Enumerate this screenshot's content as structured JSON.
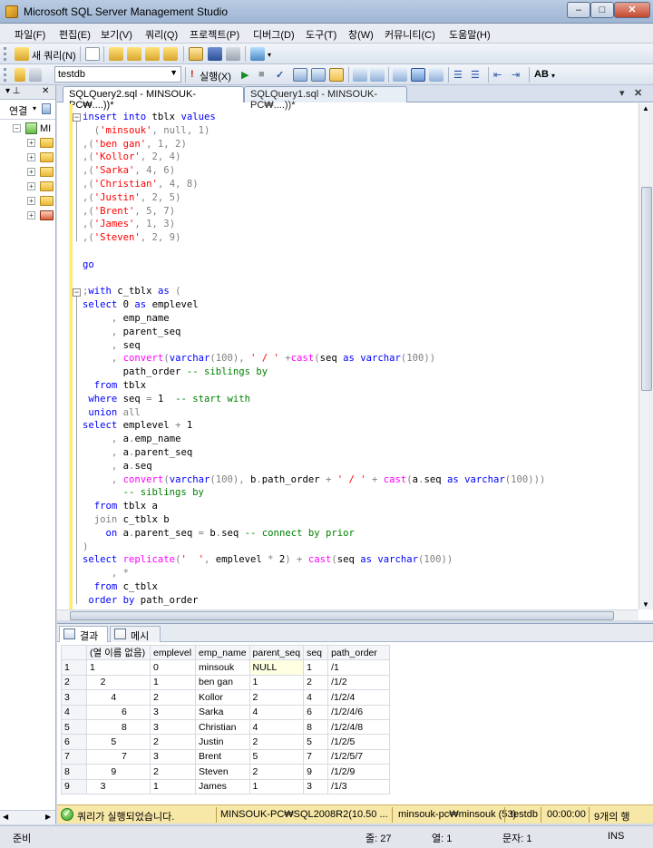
{
  "window": {
    "title": "Microsoft SQL Server Management Studio"
  },
  "menu": [
    "파일(F)",
    "편집(E)",
    "보기(V)",
    "쿼리(Q)",
    "프로젝트(P)",
    "디버그(D)",
    "도구(T)",
    "창(W)",
    "커뮤니티(C)",
    "도움말(H)"
  ],
  "toolbar": {
    "new_query_label": "새 쿼리(N)",
    "database": "testdb",
    "execute_label": "실행(X)"
  },
  "object_explorer": {
    "connect_label": "연결",
    "server_label": "MI"
  },
  "tabs": {
    "active": "SQLQuery2.sql - MINSOUK-PC₩....))*",
    "inactive": "SQLQuery1.sql - MINSOUK-PC₩....))*"
  },
  "results_tabs": {
    "results": "결과",
    "messages": "메시지"
  },
  "results": {
    "columns": [
      "(열 이름 없음)",
      "emplevel",
      "emp_name",
      "parent_seq",
      "seq",
      "path_order"
    ],
    "rows": [
      [
        "1",
        "1",
        "0",
        "minsouk",
        "NULL",
        "1",
        "/1"
      ],
      [
        "2",
        "    2",
        "1",
        "ben gan",
        "1",
        "2",
        "/1/2"
      ],
      [
        "3",
        "        4",
        "2",
        "Kollor",
        "2",
        "4",
        "/1/2/4"
      ],
      [
        "4",
        "            6",
        "3",
        "Sarka",
        "4",
        "6",
        "/1/2/4/6"
      ],
      [
        "5",
        "            8",
        "3",
        "Christian",
        "4",
        "8",
        "/1/2/4/8"
      ],
      [
        "6",
        "        5",
        "2",
        "Justin",
        "2",
        "5",
        "/1/2/5"
      ],
      [
        "7",
        "            7",
        "3",
        "Brent",
        "5",
        "7",
        "/1/2/5/7"
      ],
      [
        "8",
        "        9",
        "2",
        "Steven",
        "2",
        "9",
        "/1/2/9"
      ],
      [
        "9",
        "    3",
        "1",
        "James",
        "1",
        "3",
        "/1/3"
      ]
    ]
  },
  "status": {
    "message": "쿼리가 실행되었습니다.",
    "server": "MINSOUK-PC₩SQL2008R2(10.50 ...",
    "user": "minsouk-pc₩minsouk (53)",
    "db": "testdb",
    "time": "00:00:00",
    "rows": "9개의 행"
  },
  "bottom": {
    "ready": "준비",
    "line": "줄: 27",
    "col": "열: 1",
    "ch": "문자: 1",
    "ins": "INS"
  },
  "code": [
    [
      [
        "kw",
        "insert into "
      ],
      [
        "plain",
        "tblx "
      ],
      [
        "kw",
        "values"
      ]
    ],
    [
      [
        "gr",
        "  ("
      ],
      [
        "str",
        "'minsouk'"
      ],
      [
        "gr",
        ", null, 1)"
      ]
    ],
    [
      [
        "gr",
        ",("
      ],
      [
        "str",
        "'ben gan'"
      ],
      [
        "gr",
        ", 1, 2)"
      ]
    ],
    [
      [
        "gr",
        ",("
      ],
      [
        "str",
        "'Kollor'"
      ],
      [
        "gr",
        ", 2, 4)"
      ]
    ],
    [
      [
        "gr",
        ",("
      ],
      [
        "str",
        "'Sarka'"
      ],
      [
        "gr",
        ", 4, 6)"
      ]
    ],
    [
      [
        "gr",
        ",("
      ],
      [
        "str",
        "'Christian'"
      ],
      [
        "gr",
        ", 4, 8)"
      ]
    ],
    [
      [
        "gr",
        ",("
      ],
      [
        "str",
        "'Justin'"
      ],
      [
        "gr",
        ", 2, 5)"
      ]
    ],
    [
      [
        "gr",
        ",("
      ],
      [
        "str",
        "'Brent'"
      ],
      [
        "gr",
        ", 5, 7)"
      ]
    ],
    [
      [
        "gr",
        ",("
      ],
      [
        "str",
        "'James'"
      ],
      [
        "gr",
        ", 1, 3)"
      ]
    ],
    [
      [
        "gr",
        ",("
      ],
      [
        "str",
        "'Steven'"
      ],
      [
        "gr",
        ", 2, 9)"
      ]
    ],
    [],
    [
      [
        "kw",
        "go"
      ]
    ],
    [],
    [
      [
        "gr",
        ";"
      ],
      [
        "kw",
        "with "
      ],
      [
        "plain",
        "c_tblx "
      ],
      [
        "kw",
        "as "
      ],
      [
        "gr",
        "("
      ]
    ],
    [
      [
        "kw",
        "select "
      ],
      [
        "plain",
        "0 "
      ],
      [
        "kw",
        "as "
      ],
      [
        "plain",
        "emplevel"
      ]
    ],
    [
      [
        "gr",
        "     , "
      ],
      [
        "plain",
        "emp_name"
      ]
    ],
    [
      [
        "gr",
        "     , "
      ],
      [
        "plain",
        "parent_seq"
      ]
    ],
    [
      [
        "gr",
        "     , "
      ],
      [
        "plain",
        "seq"
      ]
    ],
    [
      [
        "gr",
        "     , "
      ],
      [
        "fn",
        "convert"
      ],
      [
        "gr",
        "("
      ],
      [
        "kw",
        "varchar"
      ],
      [
        "gr",
        "(100), "
      ],
      [
        "str",
        "' / '"
      ],
      [
        "gr",
        " +"
      ],
      [
        "fn",
        "cast"
      ],
      [
        "gr",
        "("
      ],
      [
        "plain",
        "seq "
      ],
      [
        "kw",
        "as varchar"
      ],
      [
        "gr",
        "(100))"
      ]
    ],
    [
      [
        "plain",
        "       path_order "
      ],
      [
        "cm",
        "-- siblings by"
      ]
    ],
    [
      [
        "kw",
        "  from "
      ],
      [
        "plain",
        "tblx"
      ]
    ],
    [
      [
        "kw",
        " where "
      ],
      [
        "plain",
        "seq "
      ],
      [
        "gr",
        "= "
      ],
      [
        "plain",
        "1  "
      ],
      [
        "cm",
        "-- start with"
      ]
    ],
    [
      [
        "kw",
        " union "
      ],
      [
        "gr",
        "all"
      ]
    ],
    [
      [
        "kw",
        "select "
      ],
      [
        "plain",
        "emplevel "
      ],
      [
        "gr",
        "+ "
      ],
      [
        "plain",
        "1"
      ]
    ],
    [
      [
        "gr",
        "     , "
      ],
      [
        "plain",
        "a"
      ],
      [
        "gr",
        "."
      ],
      [
        "plain",
        "emp_name"
      ]
    ],
    [
      [
        "gr",
        "     , "
      ],
      [
        "plain",
        "a"
      ],
      [
        "gr",
        "."
      ],
      [
        "plain",
        "parent_seq"
      ]
    ],
    [
      [
        "gr",
        "     , "
      ],
      [
        "plain",
        "a"
      ],
      [
        "gr",
        "."
      ],
      [
        "plain",
        "seq"
      ]
    ],
    [
      [
        "gr",
        "     , "
      ],
      [
        "fn",
        "convert"
      ],
      [
        "gr",
        "("
      ],
      [
        "kw",
        "varchar"
      ],
      [
        "gr",
        "(100), "
      ],
      [
        "plain",
        "b"
      ],
      [
        "gr",
        "."
      ],
      [
        "plain",
        "path_order "
      ],
      [
        "gr",
        "+ "
      ],
      [
        "str",
        "' / '"
      ],
      [
        "gr",
        " + "
      ],
      [
        "fn",
        "cast"
      ],
      [
        "gr",
        "("
      ],
      [
        "plain",
        "a"
      ],
      [
        "gr",
        "."
      ],
      [
        "plain",
        "seq "
      ],
      [
        "kw",
        "as varchar"
      ],
      [
        "gr",
        "(100)))"
      ]
    ],
    [
      [
        "cm",
        "       -- siblings by"
      ]
    ],
    [
      [
        "kw",
        "  from "
      ],
      [
        "plain",
        "tblx a"
      ]
    ],
    [
      [
        "gr",
        "  join "
      ],
      [
        "plain",
        "c_tblx b"
      ]
    ],
    [
      [
        "kw",
        "    on "
      ],
      [
        "plain",
        "a"
      ],
      [
        "gr",
        "."
      ],
      [
        "plain",
        "parent_seq "
      ],
      [
        "gr",
        "= "
      ],
      [
        "plain",
        "b"
      ],
      [
        "gr",
        "."
      ],
      [
        "plain",
        "seq "
      ],
      [
        "cm",
        "-- connect by prior"
      ]
    ],
    [
      [
        "gr",
        ")"
      ]
    ],
    [
      [
        "kw",
        "select "
      ],
      [
        "fn",
        "replicate"
      ],
      [
        "gr",
        "("
      ],
      [
        "str",
        "'  '"
      ],
      [
        "gr",
        ", "
      ],
      [
        "plain",
        "emplevel "
      ],
      [
        "gr",
        "* "
      ],
      [
        "plain",
        "2"
      ],
      [
        "gr",
        ") + "
      ],
      [
        "fn",
        "cast"
      ],
      [
        "gr",
        "("
      ],
      [
        "plain",
        "seq "
      ],
      [
        "kw",
        "as varchar"
      ],
      [
        "gr",
        "(100))"
      ]
    ],
    [
      [
        "gr",
        "     , *"
      ]
    ],
    [
      [
        "kw",
        "  from "
      ],
      [
        "plain",
        "c_tblx"
      ]
    ],
    [
      [
        "kw",
        " order by "
      ],
      [
        "plain",
        "path_order"
      ]
    ]
  ]
}
